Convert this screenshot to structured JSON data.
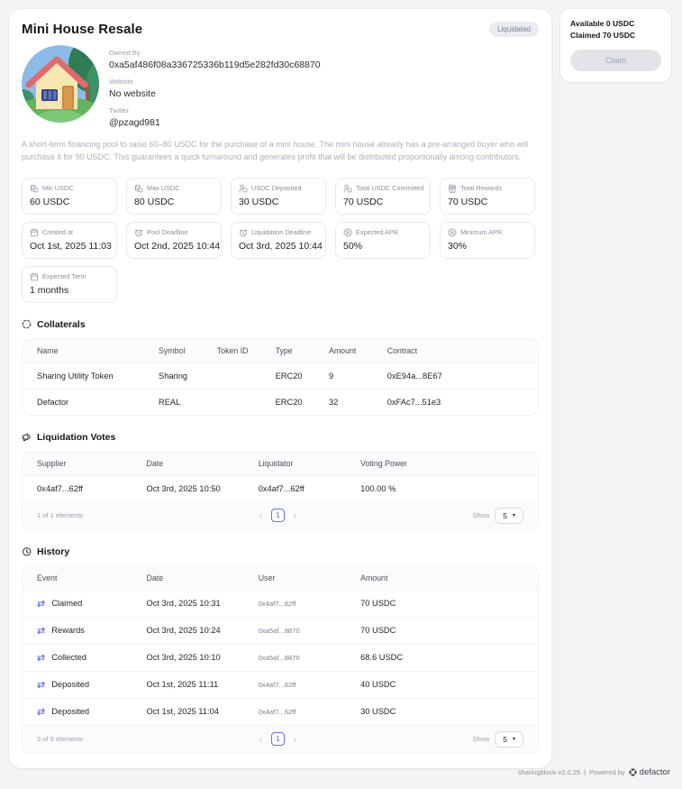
{
  "header": {
    "title": "Mini House Resale",
    "status_badge": "Liquidated"
  },
  "profile": {
    "owned_by_label": "Owned By",
    "owned_by": "0xa5af486f08a336725336b119d5e282fd30c68870",
    "website_label": "Website",
    "website": "No website",
    "twitter_label": "Twitter",
    "twitter": "@pzagd981"
  },
  "description": "A short-term financing pool to raise 60–80 USDC for the purchase of a mini house. The mini house already has a pre-arranged buyer who will purchase it for 90 USDC. This guarantees a quick turnaround and generates profit that will be distributed proportionally among contributors.",
  "claim_card": {
    "available": "Available 0 USDC",
    "claimed": "Claimed 70 USDC",
    "button": "Claim"
  },
  "stats": [
    {
      "label": "Min USDC",
      "value": "60 USDC",
      "icon": "coins-icon"
    },
    {
      "label": "Max USDC",
      "value": "80 USDC",
      "icon": "coins-icon"
    },
    {
      "label": "USDC Deposited",
      "value": "30 USDC",
      "icon": "user-coin-icon"
    },
    {
      "label": "Total USDC Committed",
      "value": "70 USDC",
      "icon": "user-coin-icon"
    },
    {
      "label": "Total Rewards",
      "value": "70 USDC",
      "icon": "gift-icon"
    },
    {
      "label": "Created at",
      "value": "Oct 1st, 2025 11:03",
      "icon": "calendar-icon"
    },
    {
      "label": "Pool Deadline",
      "value": "Oct 2nd, 2025 10:44",
      "icon": "alarm-icon"
    },
    {
      "label": "Liquidation Deadline",
      "value": "Oct 3rd, 2025 10:44",
      "icon": "alarm-icon"
    },
    {
      "label": "Expected APR",
      "value": "50%",
      "icon": "percent-icon"
    },
    {
      "label": "Minimum APR",
      "value": "30%",
      "icon": "percent-icon"
    },
    {
      "label": "Expected Term",
      "value": "1 months",
      "icon": "calendar-icon"
    }
  ],
  "collaterals": {
    "title": "Collaterals",
    "columns": [
      "Name",
      "Symbol",
      "Token ID",
      "Type",
      "Amount",
      "Contract"
    ],
    "rows": [
      [
        "Sharing Utility Token",
        "Sharing",
        "",
        "ERC20",
        "9",
        "0xE94a...8E67"
      ],
      [
        "Defactor",
        "REAL",
        "",
        "ERC20",
        "32",
        "0xFAc7...51e3"
      ]
    ]
  },
  "liquidation_votes": {
    "title": "Liquidation Votes",
    "columns": [
      "Supplier",
      "Date",
      "Liquidator",
      "Voting Power"
    ],
    "rows": [
      [
        "0x4af7...62ff",
        "Oct 3rd, 2025 10:50",
        "0x4af7...62ff",
        "100.00 %"
      ]
    ],
    "pagination": {
      "summary": "1 of 1 elements",
      "prev": "‹",
      "next": "›",
      "page": "1",
      "show_label": "Show",
      "page_size": "5",
      "caret": "▾"
    }
  },
  "history": {
    "title": "History",
    "columns": [
      "Event",
      "Date",
      "User",
      "Amount"
    ],
    "rows": [
      {
        "event": "Claimed",
        "date": "Oct 3rd, 2025 10:31",
        "user": "0x4af7...62ff",
        "amount": "70 USDC"
      },
      {
        "event": "Rewards",
        "date": "Oct 3rd, 2025 10:24",
        "user": "0xa5af...8870",
        "amount": "70 USDC"
      },
      {
        "event": "Collected",
        "date": "Oct 3rd, 2025 10:10",
        "user": "0xa5af...8870",
        "amount": "68.6 USDC"
      },
      {
        "event": "Deposited",
        "date": "Oct 1st, 2025 11:11",
        "user": "0x4af7...62ff",
        "amount": "40 USDC"
      },
      {
        "event": "Deposited",
        "date": "Oct 1st, 2025 11:04",
        "user": "0x4af7...62ff",
        "amount": "30 USDC"
      }
    ],
    "event_icon": "⇄",
    "pagination": {
      "summary": "5 of 5 elements",
      "prev": "‹",
      "next": "›",
      "page": "1",
      "show_label": "Show",
      "page_size": "5",
      "caret": "▾"
    }
  },
  "page_footer": {
    "version": "sharingblock-v2.0.25",
    "separator": "|",
    "powered_by": "Powered by",
    "brand": "defactor"
  },
  "colors": {
    "accent": "#4a4fe0",
    "badge_bg": "#eaecf1",
    "badge_text": "#7b8090",
    "status": "liquidated"
  }
}
